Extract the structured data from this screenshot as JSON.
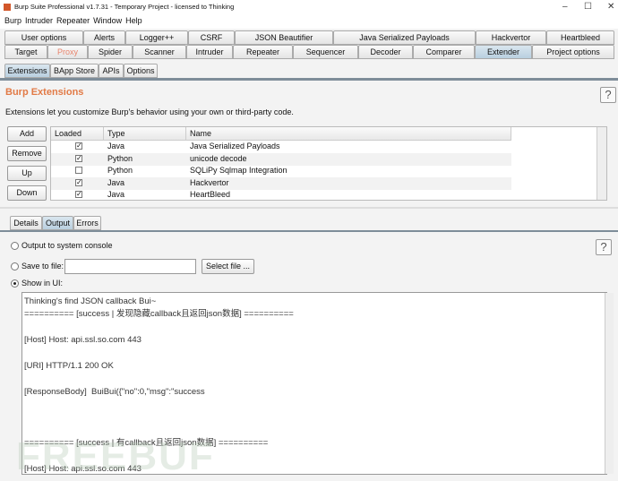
{
  "window": {
    "title": "Burp Suite Professional v1.7.31 - Temporary Project - licensed to Thinking",
    "minimize": "–",
    "maximize": "☐",
    "close": "✕"
  },
  "menu": [
    "Burp",
    "Intruder",
    "Repeater",
    "Window",
    "Help"
  ],
  "tabs_row1": [
    "User options",
    "Alerts",
    "Logger++",
    "CSRF",
    "JSON Beautifier",
    "Java Serialized Payloads",
    "Hackvertor",
    "Heartbleed"
  ],
  "tabs_row2": [
    "Target",
    "Proxy",
    "Spider",
    "Scanner",
    "Intruder",
    "Repeater",
    "Sequencer",
    "Decoder",
    "Comparer",
    "Extender",
    "Project options"
  ],
  "subtabs": [
    "Extensions",
    "BApp Store",
    "APIs",
    "Options"
  ],
  "section": {
    "title": "Burp Extensions",
    "description": "Extensions let you customize Burp's behavior using your own or third-party code.",
    "help": "?"
  },
  "buttons": {
    "add": "Add",
    "remove": "Remove",
    "up": "Up",
    "down": "Down"
  },
  "table": {
    "headers": [
      "Loaded",
      "Type",
      "Name"
    ],
    "rows": [
      {
        "loaded": true,
        "type": "Java",
        "name": "Java Serialized Payloads"
      },
      {
        "loaded": true,
        "type": "Python",
        "name": "unicode decode"
      },
      {
        "loaded": false,
        "type": "Python",
        "name": "SQLiPy Sqlmap Integration"
      },
      {
        "loaded": true,
        "type": "Java",
        "name": "Hackvertor"
      },
      {
        "loaded": true,
        "type": "Java",
        "name": "HeartBleed"
      }
    ]
  },
  "detail_tabs": [
    "Details",
    "Output",
    "Errors"
  ],
  "output_opts": {
    "console": "Output to system console",
    "file": "Save to file:",
    "file_value": "",
    "select_file": "Select file ...",
    "ui": "Show in UI:",
    "help": "?"
  },
  "output_text": "Thinking's find JSON callback Bui~\n========== [success | 发现隐藏callback且返回json数据] ==========\n\n[Host] Host: api.ssl.so.com 443\n\n[URI] HTTP/1.1 200 OK\n\n[ResponseBody]  BuiBui({\"no\":0,\"msg\":\"success\n\n\n\n========== [success | 有callback且返回json数据] ==========\n\n[Host] Host: api.ssl.so.com 443",
  "watermark": "FREEBUF"
}
